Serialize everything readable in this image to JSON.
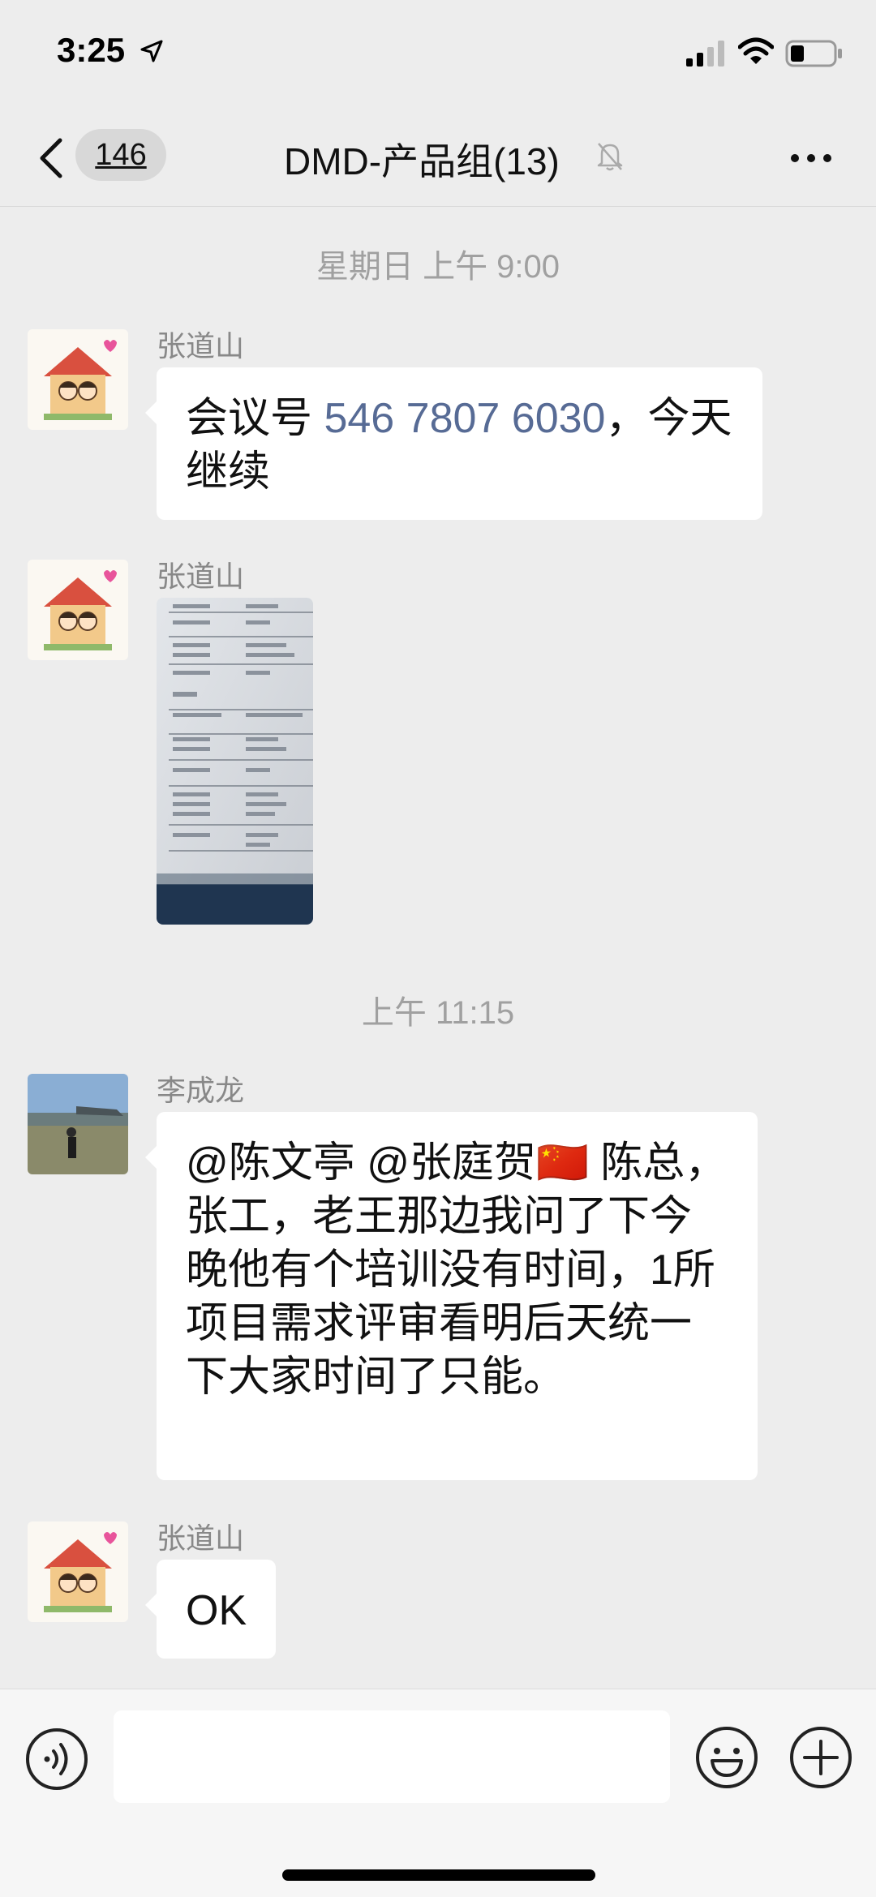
{
  "status_bar": {
    "time": "3:25"
  },
  "nav": {
    "back_badge": "146",
    "title": "DMD-产品组(13)"
  },
  "chat": {
    "timestamp_1": "星期日 上午 9:00",
    "timestamp_2": "上午 11:15",
    "messages": [
      {
        "sender": "张道山",
        "text_before": "会议号 ",
        "link": "546 7807 6030",
        "text_after": "，今天继续"
      },
      {
        "sender": "张道山",
        "type": "image"
      },
      {
        "sender": "李成龙",
        "text": "@陈文亭 @张庭贺🇨🇳 陈总，张工，老王那边我问了下今晚他有个培训没有时间，1所项目需求评审看明后天统一下大家时间了只能。"
      },
      {
        "sender": "张道山",
        "text": "OK"
      }
    ]
  },
  "colors": {
    "background": "#ededed",
    "bubble": "#ffffff",
    "link": "#576b95",
    "timestamp": "#a0a0a0"
  },
  "icons": {
    "back": "chevron-left-icon",
    "mute": "bell-slash-icon",
    "more": "ellipsis-icon",
    "voice": "voice-icon",
    "emoji": "smiley-icon",
    "plus": "plus-circle-icon"
  }
}
